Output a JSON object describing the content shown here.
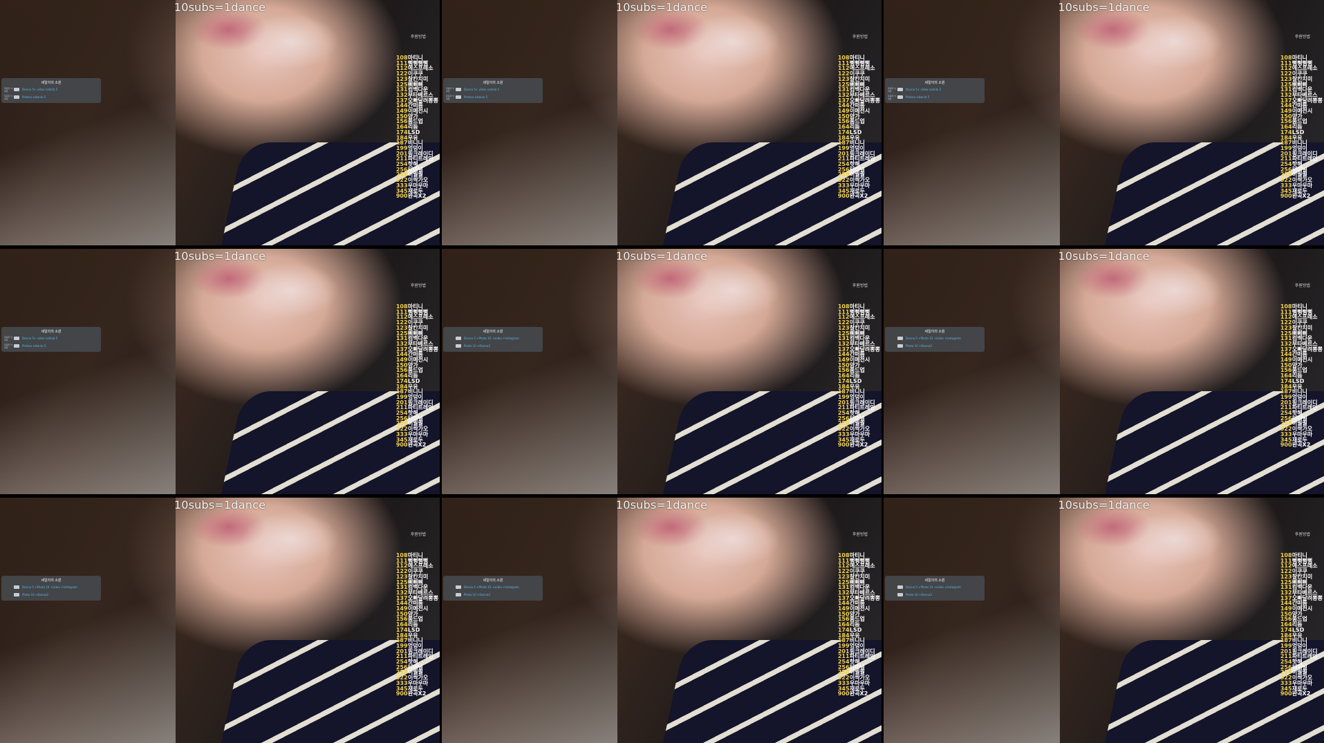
{
  "tiles": [
    {
      "caption": "10subs=1dance",
      "badge": "후원방법",
      "panel": {
        "title": "세일이의 소원",
        "rows": [
          {
            "label": "후원자 닉네임",
            "text": "Donna 5+ video nahida 5"
          },
          {
            "label": "후원자 닉네임",
            "text": "Pintoco nikanie 5"
          }
        ]
      }
    },
    {
      "caption": "10subs=1dance",
      "badge": "후원방법",
      "panel": {
        "title": "세일이의 소원",
        "rows": [
          {
            "label": "후원자 닉네임",
            "text": "Donna 5+ video nahida 5"
          },
          {
            "label": "후원자 닉네임",
            "text": "Pintoco nikanie 5"
          }
        ]
      }
    },
    {
      "caption": "10subs=1dance",
      "badge": "후원방법",
      "panel": {
        "title": "세일이의 소원",
        "rows": [
          {
            "label": "후원자 닉네임",
            "text": "Donna 5+ video nahida 5"
          },
          {
            "label": "후원자 닉네임",
            "text": "Pintoco nikanie 5"
          }
        ]
      }
    },
    {
      "caption": "10subs=1dance",
      "badge": "후원방법",
      "panel": {
        "title": "세일이의 소원",
        "rows": [
          {
            "label": "후원자 닉네임",
            "text": "Donna 5+ video nahida 5"
          },
          {
            "label": "후원자 닉네임",
            "text": "Pintoco nikanie 5"
          }
        ]
      }
    },
    {
      "caption": "10subs=1dance",
      "badge": "후원방법",
      "panel": {
        "title": "세일이의 소원",
        "rows": [
          {
            "label": "",
            "text": "Donna 5 +Photo 10 +video +Instagram"
          },
          {
            "label": "",
            "text": "Photo 10 +Donna2"
          }
        ]
      }
    },
    {
      "caption": "10subs=1dance",
      "badge": "후원방법",
      "panel": {
        "title": "세일이의 소원",
        "rows": [
          {
            "label": "",
            "text": "Donna 5 +Photo 10 +video +Instagram"
          },
          {
            "label": "",
            "text": "Photo 10 +Donna2"
          }
        ]
      }
    },
    {
      "caption": "10subs=1dance",
      "badge": "후원방법",
      "panel": {
        "title": "세일이의 소원",
        "rows": [
          {
            "label": "",
            "text": "Donna 5 +Photo 10 +video +Instagram"
          },
          {
            "label": "",
            "text": "Photo 10 +Donna2"
          }
        ]
      }
    },
    {
      "caption": "10subs=1dance",
      "badge": "후원방법",
      "panel": {
        "title": "세일이의 소원",
        "rows": [
          {
            "label": "",
            "text": "Donna 5 +Photo 10 +video +Instagram"
          },
          {
            "label": "",
            "text": "Photo 10 +Donna2"
          }
        ]
      }
    },
    {
      "caption": "10subs=1dance",
      "badge": "후원방법",
      "panel": {
        "title": "세일이의 소원",
        "rows": [
          {
            "label": "",
            "text": "Donna 5 +Photo 10 +video +Instagram"
          },
          {
            "label": "",
            "text": "Photo 10 +Donna2"
          }
        ]
      }
    }
  ],
  "menu": [
    {
      "num": "108",
      "name": "마티니"
    },
    {
      "num": "111",
      "name": "뻥뻥뻥뻥"
    },
    {
      "num": "112",
      "name": "에스프레소"
    },
    {
      "num": "122",
      "name": "이쿠쿠"
    },
    {
      "num": "123",
      "name": "찰칸치미"
    },
    {
      "num": "125",
      "name": "삐삐삐"
    },
    {
      "num": "131",
      "name": "컴백다운"
    },
    {
      "num": "132",
      "name": "부타베르스"
    },
    {
      "num": "137",
      "name": "오빠달려뽕뽕"
    },
    {
      "num": "144",
      "name": "간떠름"
    },
    {
      "num": "149",
      "name": "이메전시"
    },
    {
      "num": "150",
      "name": "양가"
    },
    {
      "num": "156",
      "name": "품드업"
    },
    {
      "num": "164",
      "name": "리듬"
    },
    {
      "num": "174",
      "name": "LSD"
    },
    {
      "num": "184",
      "name": "우유"
    },
    {
      "num": "187",
      "name": "비니니"
    },
    {
      "num": "199",
      "name": "엉덩이"
    },
    {
      "num": "201",
      "name": "핑크레이디"
    },
    {
      "num": "211",
      "name": "파티트레인"
    },
    {
      "num": "254",
      "name": "핫해"
    },
    {
      "num": "256",
      "name": "티미널"
    },
    {
      "num": "258",
      "name": "이퀄퀄"
    },
    {
      "num": "322",
      "name": "이싹가오"
    },
    {
      "num": "333",
      "name": "우마우마"
    },
    {
      "num": "345",
      "name": "재로두"
    },
    {
      "num": "900",
      "name": "완곡X2"
    }
  ]
}
